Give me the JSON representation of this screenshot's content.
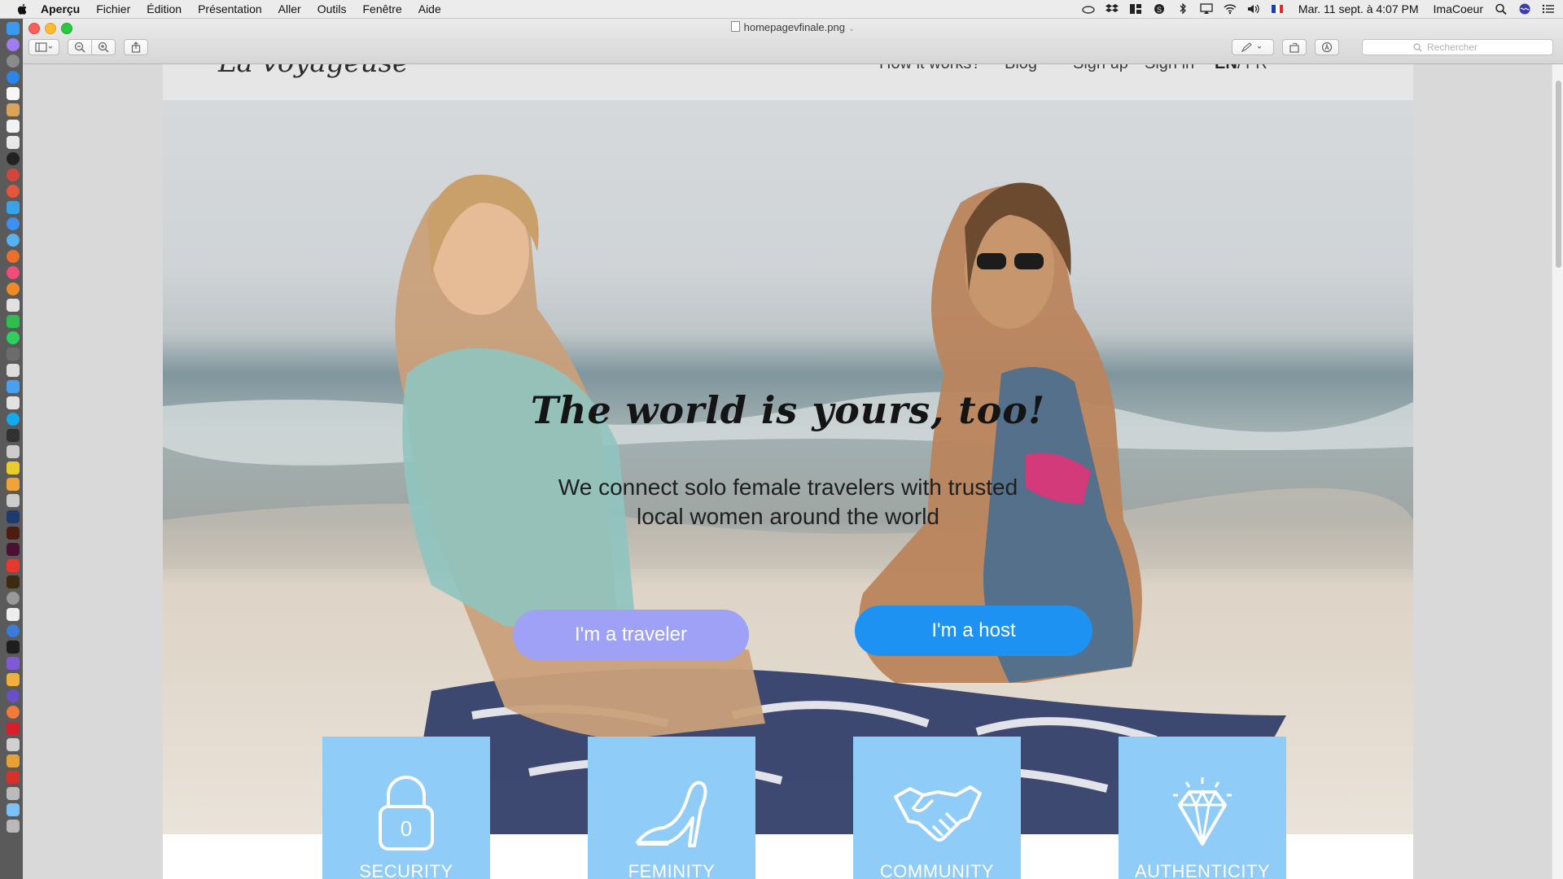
{
  "menubar": {
    "app_name": "Aperçu",
    "items": [
      "Fichier",
      "Édition",
      "Présentation",
      "Aller",
      "Outils",
      "Fenêtre",
      "Aide"
    ],
    "datetime": "Mar. 11 sept. à 4:07 PM",
    "user": "ImaCoeur"
  },
  "window": {
    "title": "homepagevfinale.png",
    "search_placeholder": "Rechercher"
  },
  "site": {
    "logo": "La voyageuse",
    "nav": [
      "How it works?",
      "Blog",
      "Sign up",
      "Sign in"
    ],
    "lang_en": "EN",
    "lang_sep": "/",
    "lang_fr": "FR",
    "headline": "The world is yours, too!",
    "subheadline_line1": "We connect solo female travelers with trusted",
    "subheadline_line2": "local women around the world",
    "cta_traveler": "I'm a traveler",
    "cta_host": "I'm a host",
    "features": [
      {
        "label": "SECURITY",
        "icon": "padlock-icon"
      },
      {
        "label": "FEMINITY",
        "icon": "high-heel-icon"
      },
      {
        "label": "COMMUNITY",
        "icon": "handshake-icon"
      },
      {
        "label": "AUTHENTICITY",
        "icon": "diamond-icon"
      }
    ],
    "lock_code": "0"
  },
  "colors": {
    "traveler_button": "#9ea1f5",
    "host_button": "#1e92f3",
    "feature_tile": "#8fccf8"
  }
}
